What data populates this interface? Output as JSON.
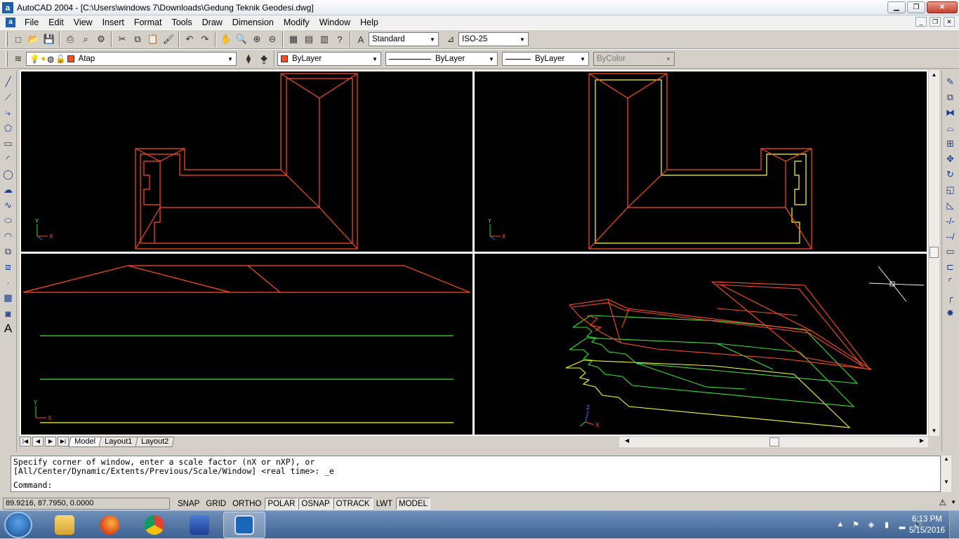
{
  "window": {
    "title": "AutoCAD 2004 - [C:\\Users\\windows 7\\Downloads\\Gedung Teknik Geodesi.dwg]"
  },
  "menu": [
    "File",
    "Edit",
    "View",
    "Insert",
    "Format",
    "Tools",
    "Draw",
    "Dimension",
    "Modify",
    "Window",
    "Help"
  ],
  "styles": {
    "text_style": "Standard",
    "dim_style": "ISO-25"
  },
  "layers": {
    "current": "Atap",
    "color": "ByLayer",
    "linetype": "ByLayer",
    "lineweight": "ByLayer",
    "plotstyle": "ByColor"
  },
  "colors": {
    "red": "#ff4b1f",
    "yellow": "#ffff33",
    "green": "#38e038"
  },
  "viewports": {
    "axis_labels": {
      "x": "X",
      "y": "Y",
      "z": "Z"
    }
  },
  "tabs": [
    "Model",
    "Layout1",
    "Layout2"
  ],
  "command": {
    "line1": "Specify corner of window, enter a scale factor (nX or nXP), or",
    "line2": "[All/Center/Dynamic/Extents/Previous/Scale/Window] <real time>: _e",
    "prompt": "Command:"
  },
  "status": {
    "coords": "89.9216, 87.7950, 0.0000",
    "buttons": [
      {
        "label": "SNAP",
        "on": false
      },
      {
        "label": "GRID",
        "on": false
      },
      {
        "label": "ORTHO",
        "on": false
      },
      {
        "label": "POLAR",
        "on": true
      },
      {
        "label": "OSNAP",
        "on": true
      },
      {
        "label": "OTRACK",
        "on": true
      },
      {
        "label": "LWT",
        "on": false
      },
      {
        "label": "MODEL",
        "on": true
      }
    ]
  },
  "taskbar": {
    "time": "6:13 PM",
    "date": "5/15/2016"
  }
}
